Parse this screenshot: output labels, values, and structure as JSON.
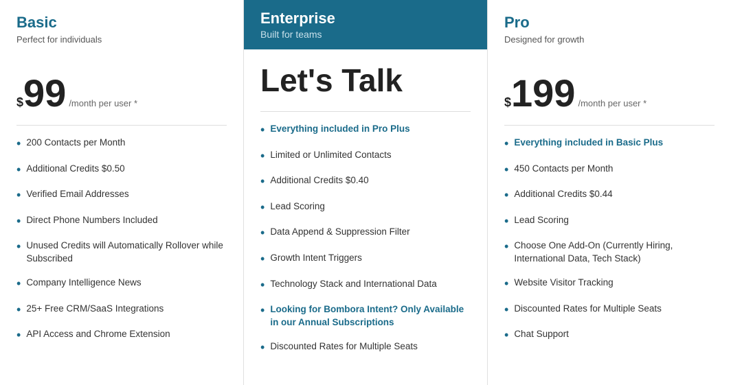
{
  "plans": [
    {
      "id": "basic",
      "name": "Basic",
      "subtitle": "Perfect for individuals",
      "price_symbol": "$",
      "price_amount": "99",
      "price_suffix": "/month per user *",
      "cta": null,
      "features": [
        {
          "text": "200 Contacts per Month",
          "bold": false
        },
        {
          "text": "Additional Credits $0.50",
          "bold": false
        },
        {
          "text": "Verified Email Addresses",
          "bold": false
        },
        {
          "text": "Direct Phone Numbers Included",
          "bold": false
        },
        {
          "text": "Unused Credits will Automatically Rollover while Subscribed",
          "bold": false
        },
        {
          "text": "Company Intelligence News",
          "bold": false
        },
        {
          "text": "25+ Free CRM/SaaS Integrations",
          "bold": false
        },
        {
          "text": "API Access and Chrome Extension",
          "bold": false
        }
      ]
    },
    {
      "id": "enterprise",
      "name": "Enterprise",
      "subtitle": "Built for teams",
      "price_symbol": null,
      "price_amount": null,
      "price_suffix": null,
      "cta": "Let's Talk",
      "features": [
        {
          "text": "Everything included in Pro Plus",
          "bold": true
        },
        {
          "text": "Limited or Unlimited Contacts",
          "bold": false
        },
        {
          "text": "Additional Credits $0.40",
          "bold": false
        },
        {
          "text": "Lead Scoring",
          "bold": false
        },
        {
          "text": "Data Append & Suppression Filter",
          "bold": false
        },
        {
          "text": "Growth Intent Triggers",
          "bold": false
        },
        {
          "text": "Technology Stack and International Data",
          "bold": false
        },
        {
          "text": "Looking for Bombora Intent? Only Available in our Annual Subscriptions",
          "bold": true
        },
        {
          "text": "Discounted Rates for Multiple Seats",
          "bold": false
        }
      ]
    },
    {
      "id": "pro",
      "name": "Pro",
      "subtitle": "Designed for growth",
      "price_symbol": "$",
      "price_amount": "199",
      "price_suffix": "/month per user *",
      "cta": null,
      "features": [
        {
          "text": "Everything included in Basic Plus",
          "bold": true
        },
        {
          "text": "450 Contacts per Month",
          "bold": false
        },
        {
          "text": "Additional Credits $0.44",
          "bold": false
        },
        {
          "text": "Lead Scoring",
          "bold": false
        },
        {
          "text": "Choose One Add-On (Currently Hiring, International Data, Tech Stack)",
          "bold": false
        },
        {
          "text": "Website Visitor Tracking",
          "bold": false
        },
        {
          "text": "Discounted Rates for Multiple Seats",
          "bold": false
        },
        {
          "text": "Chat Support",
          "bold": false
        }
      ]
    }
  ]
}
